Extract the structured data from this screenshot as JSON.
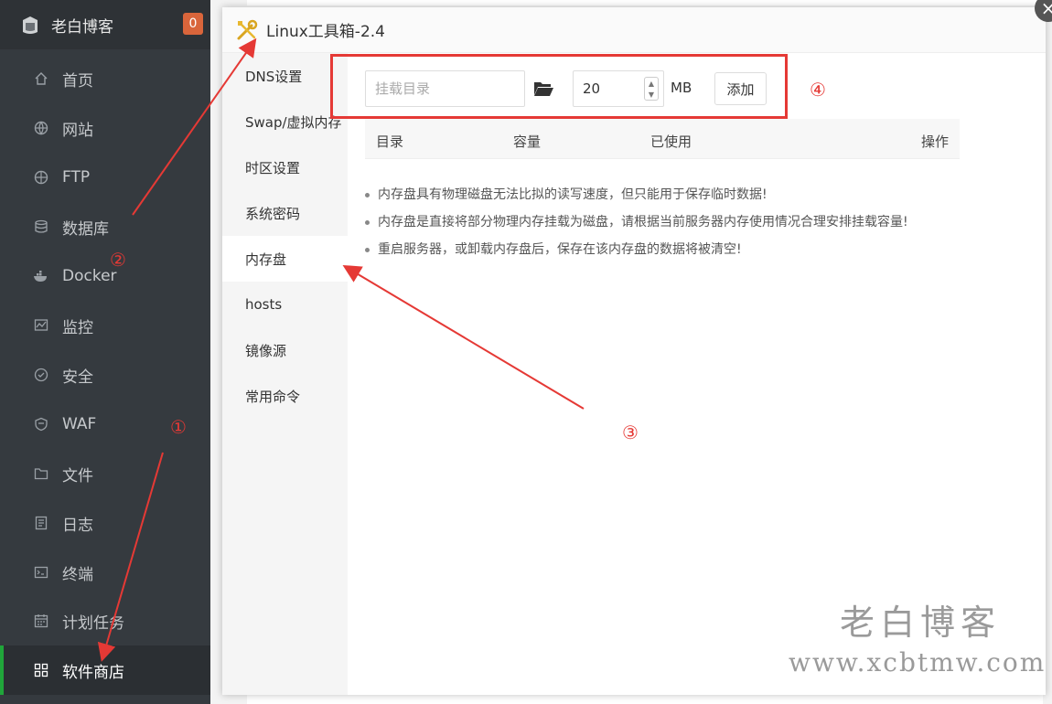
{
  "sidebar": {
    "title": "老白博客",
    "badge": "0",
    "items": [
      {
        "label": "首页",
        "icon": "home-icon"
      },
      {
        "label": "网站",
        "icon": "globe-icon"
      },
      {
        "label": "FTP",
        "icon": "ftp-icon"
      },
      {
        "label": "数据库",
        "icon": "database-icon"
      },
      {
        "label": "Docker",
        "icon": "docker-icon"
      },
      {
        "label": "监控",
        "icon": "monitor-icon"
      },
      {
        "label": "安全",
        "icon": "shield-icon"
      },
      {
        "label": "WAF",
        "icon": "waf-icon"
      },
      {
        "label": "文件",
        "icon": "folder-icon"
      },
      {
        "label": "日志",
        "icon": "log-icon"
      },
      {
        "label": "终端",
        "icon": "terminal-icon"
      },
      {
        "label": "计划任务",
        "icon": "calendar-icon"
      },
      {
        "label": "软件商店",
        "icon": "grid-icon"
      }
    ]
  },
  "modal": {
    "title": "Linux工具箱-2.4",
    "tabs": [
      "DNS设置",
      "Swap/虚拟内存",
      "时区设置",
      "系统密码",
      "内存盘",
      "hosts",
      "镜像源",
      "常用命令"
    ],
    "active_tab": "内存盘",
    "form": {
      "dir_placeholder": "挂载目录",
      "size_value": "20",
      "unit": "MB",
      "add_label": "添加"
    },
    "table_headers": [
      "目录",
      "容量",
      "已使用",
      "操作"
    ],
    "notes": [
      "内存盘具有物理磁盘无法比拟的读写速度，但只能用于保存临时数据!",
      "内存盘是直接将部分物理内存挂载为磁盘，请根据当前服务器内存使用情况合理安排挂载容量!",
      "重启服务器，或卸载内存盘后，保存在该内存盘的数据将被清空!"
    ]
  },
  "annotations": {
    "n1": "①",
    "n2": "②",
    "n3": "③",
    "n4": "④",
    "color": "#e53935"
  },
  "watermark": {
    "line1": "老白博客",
    "line2": "www.xcbtmw.com"
  },
  "colors": {
    "sidebar_bg": "#353a3f",
    "active_accent": "#20a53a",
    "badge": "#d9653b"
  }
}
